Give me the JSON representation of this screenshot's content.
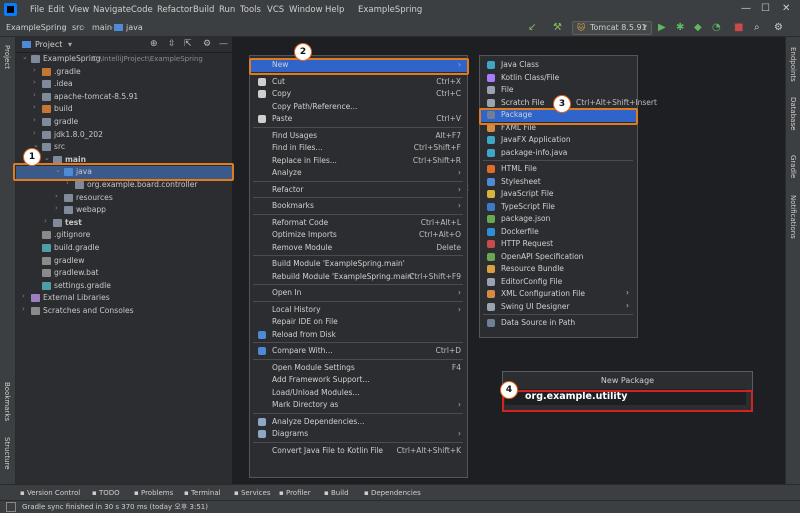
{
  "menubar": {
    "items": [
      "File",
      "Edit",
      "View",
      "Navigate",
      "Code",
      "Refactor",
      "Build",
      "Run",
      "Tools",
      "VCS",
      "Window",
      "Help"
    ],
    "title": "ExampleSpring"
  },
  "navbar": {
    "crumbs": [
      "ExampleSpring",
      "src",
      "main",
      "java"
    ],
    "run_config": "Tomcat 8.5.91"
  },
  "project_panel": {
    "title": "Project",
    "root_label": "ExampleSpring",
    "root_path": "D:\\IntelliJProject\\ExampleSpring",
    "tree": [
      {
        "label": "ExampleSpring",
        "indent": 0,
        "arrow": "v",
        "color": "#7f8b9b"
      },
      {
        "label": ".gradle",
        "indent": 1,
        "arrow": ">",
        "color": "#c57633"
      },
      {
        "label": ".idea",
        "indent": 1,
        "arrow": ">",
        "color": "#7f8b9b"
      },
      {
        "label": "apache-tomcat-8.5.91",
        "indent": 1,
        "arrow": ">",
        "color": "#7f8b9b"
      },
      {
        "label": "build",
        "indent": 1,
        "arrow": ">",
        "color": "#c57633"
      },
      {
        "label": "gradle",
        "indent": 1,
        "arrow": ">",
        "color": "#7f8b9b"
      },
      {
        "label": "jdk1.8.0_202",
        "indent": 1,
        "arrow": ">",
        "color": "#7f8b9b"
      },
      {
        "label": "src",
        "indent": 1,
        "arrow": "v",
        "color": "#7f8b9b"
      },
      {
        "label": "main",
        "indent": 2,
        "arrow": "v",
        "color": "#7f8b9b"
      },
      {
        "label": "java",
        "indent": 3,
        "arrow": "v",
        "color": "#4e8ad6",
        "selected": true
      },
      {
        "label": "org.example.board.controller",
        "indent": 4,
        "arrow": ">",
        "color": "#7f8b9b"
      },
      {
        "label": "resources",
        "indent": 3,
        "arrow": ">",
        "color": "#7f8b9b"
      },
      {
        "label": "webapp",
        "indent": 3,
        "arrow": ">",
        "color": "#7f8b9b"
      },
      {
        "label": "test",
        "indent": 2,
        "arrow": ">",
        "color": "#7f8b9b"
      },
      {
        "label": ".gitignore",
        "indent": 1,
        "arrow": "",
        "color": "#8a8a8a"
      },
      {
        "label": "build.gradle",
        "indent": 1,
        "arrow": "",
        "color": "#4e9ea8"
      },
      {
        "label": "gradlew",
        "indent": 1,
        "arrow": "",
        "color": "#8a8a8a"
      },
      {
        "label": "gradlew.bat",
        "indent": 1,
        "arrow": "",
        "color": "#8a8a8a"
      },
      {
        "label": "settings.gradle",
        "indent": 1,
        "arrow": "",
        "color": "#4e9ea8"
      },
      {
        "label": "External Libraries",
        "indent": 0,
        "arrow": ">",
        "color": "#9b7fc2"
      },
      {
        "label": "Scratches and Consoles",
        "indent": 0,
        "arrow": ">",
        "color": "#8a8a8a"
      }
    ]
  },
  "context_menu": {
    "items": [
      {
        "label": "New",
        "shortcut": ">",
        "hl": true
      },
      {
        "sep": true
      },
      {
        "label": "Cut",
        "shortcut": "Ctrl+X",
        "icon": "#cfcfcf"
      },
      {
        "label": "Copy",
        "shortcut": "Ctrl+C",
        "icon": "#cfcfcf"
      },
      {
        "label": "Copy Path/Reference...",
        "shortcut": ""
      },
      {
        "label": "Paste",
        "shortcut": "Ctrl+V",
        "icon": "#cfcfcf"
      },
      {
        "sep": true
      },
      {
        "label": "Find Usages",
        "shortcut": "Alt+F7"
      },
      {
        "label": "Find in Files...",
        "shortcut": "Ctrl+Shift+F"
      },
      {
        "label": "Replace in Files...",
        "shortcut": "Ctrl+Shift+R"
      },
      {
        "label": "Analyze",
        "shortcut": ">"
      },
      {
        "sep": true
      },
      {
        "label": "Refactor",
        "shortcut": ">"
      },
      {
        "sep": true
      },
      {
        "label": "Bookmarks",
        "shortcut": ">"
      },
      {
        "sep": true
      },
      {
        "label": "Reformat Code",
        "shortcut": "Ctrl+Alt+L"
      },
      {
        "label": "Optimize Imports",
        "shortcut": "Ctrl+Alt+O"
      },
      {
        "label": "Remove Module",
        "shortcut": "Delete"
      },
      {
        "sep": true
      },
      {
        "label": "Build Module 'ExampleSpring.main'",
        "shortcut": ""
      },
      {
        "label": "Rebuild Module 'ExampleSpring.main'",
        "shortcut": "Ctrl+Shift+F9"
      },
      {
        "sep": true
      },
      {
        "label": "Open In",
        "shortcut": ">"
      },
      {
        "sep": true
      },
      {
        "label": "Local History",
        "shortcut": ">"
      },
      {
        "label": "Repair IDE on File",
        "shortcut": ""
      },
      {
        "label": "Reload from Disk",
        "shortcut": "",
        "icon": "#4e8ad6"
      },
      {
        "sep": true
      },
      {
        "label": "Compare With...",
        "shortcut": "Ctrl+D",
        "icon": "#4e8ad6"
      },
      {
        "sep": true
      },
      {
        "label": "Open Module Settings",
        "shortcut": "F4"
      },
      {
        "label": "Add Framework Support...",
        "shortcut": ""
      },
      {
        "label": "Load/Unload Modules...",
        "shortcut": ""
      },
      {
        "label": "Mark Directory as",
        "shortcut": ">"
      },
      {
        "sep": true
      },
      {
        "label": "Analyze Dependencies...",
        "shortcut": "",
        "icon": "#8fa7c7"
      },
      {
        "label": "Diagrams",
        "shortcut": ">",
        "icon": "#8fa7c7"
      },
      {
        "sep": true
      },
      {
        "label": "Convert Java File to Kotlin File",
        "shortcut": "Ctrl+Alt+Shift+K"
      }
    ]
  },
  "new_submenu": {
    "items": [
      {
        "label": "Java Class",
        "icon": "#3ea7c8"
      },
      {
        "label": "Kotlin Class/File",
        "icon": "#a97bff"
      },
      {
        "label": "File",
        "icon": "#9aa4b0"
      },
      {
        "label": "Scratch File",
        "shortcut": "Ctrl+Alt+Shift+Insert",
        "icon": "#9aa4b0"
      },
      {
        "label": "Package",
        "icon": "#6f7f96",
        "hl": true
      },
      {
        "label": "FXML File",
        "icon": "#d68b45"
      },
      {
        "label": "JavaFX Application",
        "icon": "#3ea7c8"
      },
      {
        "label": "package-info.java",
        "icon": "#3ea7c8"
      },
      {
        "sep": true
      },
      {
        "label": "HTML File",
        "icon": "#e06c2b"
      },
      {
        "label": "Stylesheet",
        "icon": "#4e8ad6"
      },
      {
        "label": "JavaScript File",
        "icon": "#d6b53e"
      },
      {
        "label": "TypeScript File",
        "icon": "#3b7bc8"
      },
      {
        "label": "package.json",
        "icon": "#6aa84f"
      },
      {
        "label": "Dockerfile",
        "icon": "#2f8fd6"
      },
      {
        "label": "HTTP Request",
        "icon": "#c94a4a"
      },
      {
        "label": "OpenAPI Specification",
        "icon": "#6aa84f"
      },
      {
        "label": "Resource Bundle",
        "icon": "#d6a13e"
      },
      {
        "label": "EditorConfig File",
        "icon": "#9aa4b0"
      },
      {
        "label": "XML Configuration File",
        "icon": "#d68b45",
        "arrow": ">"
      },
      {
        "label": "Swing UI Designer",
        "icon": "#9aa4b0",
        "arrow": ">"
      },
      {
        "sep": true
      },
      {
        "label": "Data Source in Path",
        "icon": "#6f7f96"
      }
    ]
  },
  "new_package_dialog": {
    "title": "New Package",
    "value": "org.example.utility"
  },
  "editor_fragment": "ft",
  "badges": [
    "1",
    "2",
    "3",
    "4"
  ],
  "left_strip": {
    "top": "Project",
    "bottom1": "Bookmarks",
    "bottom2": "Structure"
  },
  "right_strip": [
    "Endpoints",
    "Database",
    "Gradle",
    "Notifications"
  ],
  "bottom_tabs": [
    "Version Control",
    "TODO",
    "Problems",
    "Terminal",
    "Services",
    "Profiler",
    "Build",
    "Dependencies"
  ],
  "status_text": "Gradle sync finished in 30 s 370 ms (today 오후 3:51)",
  "colors": {
    "selection": "#3b5a8c",
    "highlight": "#2f65ca",
    "callout": "#e07b20",
    "input_border": "#d32222"
  }
}
